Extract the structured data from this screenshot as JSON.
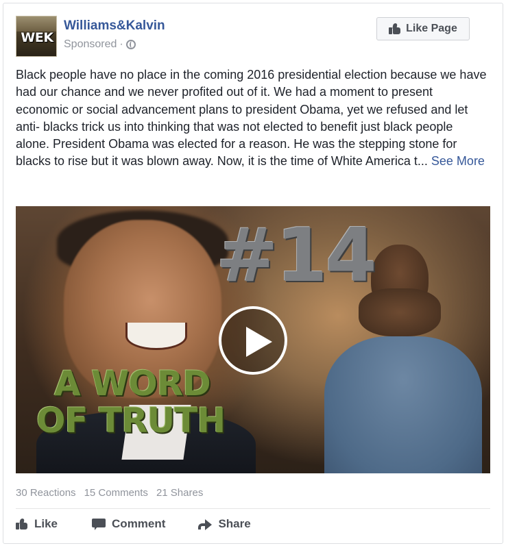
{
  "header": {
    "page_name": "Williams&Kalvin",
    "logo_text": "WEK",
    "sponsored_label": "Sponsored",
    "separator": "·",
    "audience_icon": "globe-icon",
    "like_page_label": "Like Page",
    "like_page_icon": "thumbs-up-icon"
  },
  "post": {
    "text": "Black people have no place in the coming 2016 presidential election because we have had our chance and we never profited out of it. We had a moment to present economic or social advancement plans to president Obama, yet we refused and let anti- blacks trick us into thinking that was not elected to benefit just black people alone. President Obama was elected for a reason. He was the stepping stone for blacks to rise but it was blown away. Now, it is the time of White America t...",
    "see_more_label": "See More"
  },
  "video": {
    "overlay_number": "#14",
    "caption_line1": "A WORD",
    "caption_line2": "OF TRUTH",
    "play_icon": "play-icon"
  },
  "stats": {
    "reactions": "30 Reactions",
    "comments": "15 Comments",
    "shares": "21 Shares"
  },
  "actions": {
    "like_label": "Like",
    "comment_label": "Comment",
    "share_label": "Share"
  },
  "colors": {
    "link_blue": "#365899",
    "meta_gray": "#90949c",
    "action_gray": "#4b4f56",
    "caption_green": "#6c8b37"
  }
}
